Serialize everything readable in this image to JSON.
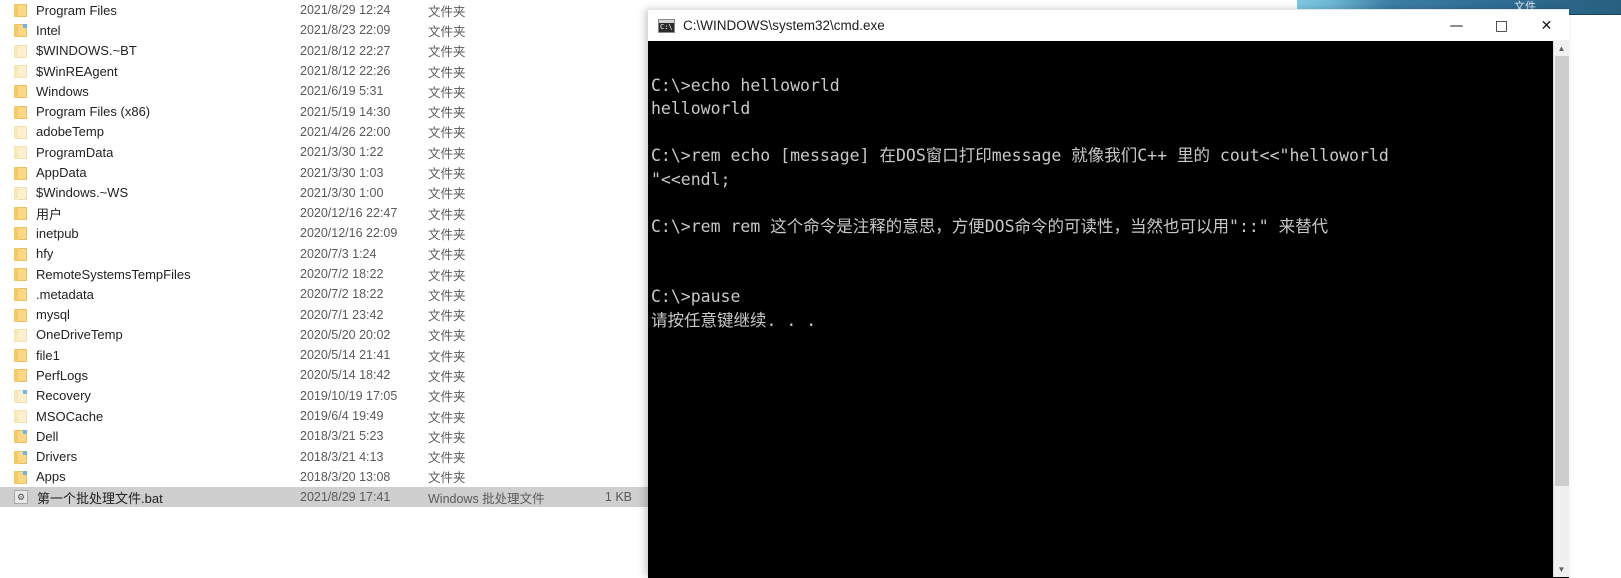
{
  "background": {
    "strip_label": "文件"
  },
  "explorer": {
    "rows": [
      {
        "name": "Program Files",
        "date": "2021/8/29 12:24",
        "type": "文件夹",
        "size": "",
        "icon": "folder-icon",
        "icon_style": "normal",
        "corner": false
      },
      {
        "name": "Intel",
        "date": "2021/8/23 22:09",
        "type": "文件夹",
        "size": "",
        "icon": "folder-icon",
        "icon_style": "normal",
        "corner": true
      },
      {
        "name": "$WINDOWS.~BT",
        "date": "2021/8/12 22:27",
        "type": "文件夹",
        "size": "",
        "icon": "folder-icon",
        "icon_style": "pale",
        "corner": false
      },
      {
        "name": "$WinREAgent",
        "date": "2021/8/12 22:26",
        "type": "文件夹",
        "size": "",
        "icon": "folder-icon",
        "icon_style": "pale",
        "corner": false
      },
      {
        "name": "Windows",
        "date": "2021/6/19 5:31",
        "type": "文件夹",
        "size": "",
        "icon": "folder-icon",
        "icon_style": "normal",
        "corner": false
      },
      {
        "name": "Program Files (x86)",
        "date": "2021/5/19 14:30",
        "type": "文件夹",
        "size": "",
        "icon": "folder-icon",
        "icon_style": "normal",
        "corner": false
      },
      {
        "name": "adobeTemp",
        "date": "2021/4/26 22:00",
        "type": "文件夹",
        "size": "",
        "icon": "folder-icon",
        "icon_style": "pale",
        "corner": false
      },
      {
        "name": "ProgramData",
        "date": "2021/3/30 1:22",
        "type": "文件夹",
        "size": "",
        "icon": "folder-icon",
        "icon_style": "pale",
        "corner": false
      },
      {
        "name": "AppData",
        "date": "2021/3/30 1:03",
        "type": "文件夹",
        "size": "",
        "icon": "folder-icon",
        "icon_style": "normal",
        "corner": false
      },
      {
        "name": "$Windows.~WS",
        "date": "2021/3/30 1:00",
        "type": "文件夹",
        "size": "",
        "icon": "folder-icon",
        "icon_style": "pale",
        "corner": false
      },
      {
        "name": "用户",
        "date": "2020/12/16 22:47",
        "type": "文件夹",
        "size": "",
        "icon": "folder-icon",
        "icon_style": "normal",
        "corner": false
      },
      {
        "name": "inetpub",
        "date": "2020/12/16 22:09",
        "type": "文件夹",
        "size": "",
        "icon": "folder-icon",
        "icon_style": "normal",
        "corner": false
      },
      {
        "name": "hfy",
        "date": "2020/7/3 1:24",
        "type": "文件夹",
        "size": "",
        "icon": "folder-icon",
        "icon_style": "normal",
        "corner": false
      },
      {
        "name": "RemoteSystemsTempFiles",
        "date": "2020/7/2 18:22",
        "type": "文件夹",
        "size": "",
        "icon": "folder-icon",
        "icon_style": "normal",
        "corner": false
      },
      {
        "name": ".metadata",
        "date": "2020/7/2 18:22",
        "type": "文件夹",
        "size": "",
        "icon": "folder-icon",
        "icon_style": "normal",
        "corner": false
      },
      {
        "name": "mysql",
        "date": "2020/7/1 23:42",
        "type": "文件夹",
        "size": "",
        "icon": "folder-icon",
        "icon_style": "normal",
        "corner": false
      },
      {
        "name": "OneDriveTemp",
        "date": "2020/5/20 20:02",
        "type": "文件夹",
        "size": "",
        "icon": "folder-icon",
        "icon_style": "pale",
        "corner": false
      },
      {
        "name": "file1",
        "date": "2020/5/14 21:41",
        "type": "文件夹",
        "size": "",
        "icon": "folder-icon",
        "icon_style": "normal",
        "corner": false
      },
      {
        "name": "PerfLogs",
        "date": "2020/5/14 18:42",
        "type": "文件夹",
        "size": "",
        "icon": "folder-icon",
        "icon_style": "normal",
        "corner": false
      },
      {
        "name": "Recovery",
        "date": "2019/10/19 17:05",
        "type": "文件夹",
        "size": "",
        "icon": "folder-icon",
        "icon_style": "pale",
        "corner": true
      },
      {
        "name": "MSOCache",
        "date": "2019/6/4 19:49",
        "type": "文件夹",
        "size": "",
        "icon": "folder-icon",
        "icon_style": "pale",
        "corner": false
      },
      {
        "name": "Dell",
        "date": "2018/3/21 5:23",
        "type": "文件夹",
        "size": "",
        "icon": "folder-icon",
        "icon_style": "normal",
        "corner": true
      },
      {
        "name": "Drivers",
        "date": "2018/3/21 4:13",
        "type": "文件夹",
        "size": "",
        "icon": "folder-icon",
        "icon_style": "normal",
        "corner": true
      },
      {
        "name": "Apps",
        "date": "2018/3/20 13:08",
        "type": "文件夹",
        "size": "",
        "icon": "folder-icon",
        "icon_style": "normal",
        "corner": true
      },
      {
        "name": "第一个批处理文件.bat",
        "date": "2021/8/29 17:41",
        "type": "Windows 批处理文件",
        "size": "1 KB",
        "icon": "bat-file-icon",
        "icon_style": "bat",
        "corner": false,
        "selected": true
      }
    ]
  },
  "cmd": {
    "title": "C:\\WINDOWS\\system32\\cmd.exe",
    "icon": "console-icon",
    "controls": {
      "minimize": "—",
      "maximize": "□",
      "close": "✕"
    },
    "scrollbar": {
      "up_arrow": "▲",
      "down_arrow": "▼"
    },
    "console_lines": [
      "",
      "C:\\>echo helloworld",
      "helloworld",
      "",
      "C:\\>rem echo [message] 在DOS窗口打印message 就像我们C++ 里的 cout<<\"helloworld",
      "\"<<endl;",
      "",
      "C:\\>rem rem 这个命令是注释的意思，方便DOS命令的可读性，当然也可以用\"::\" 来替代",
      "",
      "",
      "C:\\>pause",
      "请按任意键继续. . ."
    ]
  }
}
